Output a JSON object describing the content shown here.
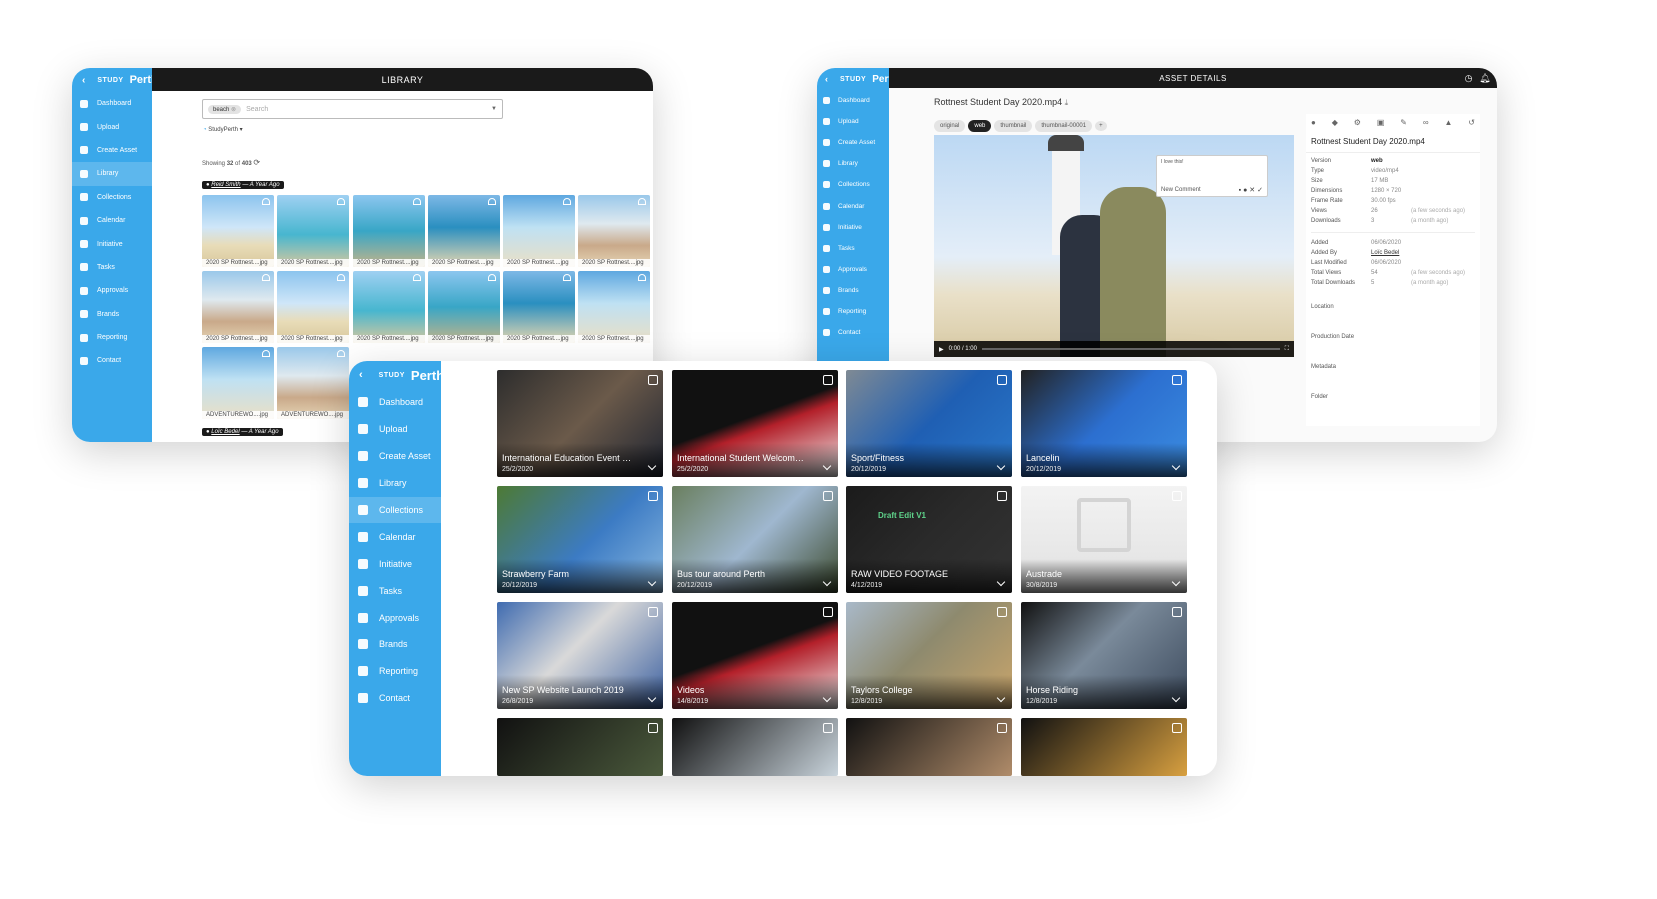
{
  "brand": {
    "study": "STUDY",
    "name": "Perth"
  },
  "nav": [
    {
      "label": "Dashboard",
      "icon": "dashboard-icon"
    },
    {
      "label": "Upload",
      "icon": "cloud-upload-icon"
    },
    {
      "label": "Create Asset",
      "icon": "create-asset-icon"
    },
    {
      "label": "Library",
      "icon": "library-icon"
    },
    {
      "label": "Collections",
      "icon": "collections-icon"
    },
    {
      "label": "Calendar",
      "icon": "calendar-icon"
    },
    {
      "label": "Initiative",
      "icon": "initiative-icon"
    },
    {
      "label": "Tasks",
      "icon": "tasks-icon"
    },
    {
      "label": "Approvals",
      "icon": "thumbs-up-icon"
    },
    {
      "label": "Brands",
      "icon": "brands-icon"
    },
    {
      "label": "Reporting",
      "icon": "reporting-icon"
    },
    {
      "label": "Contact",
      "icon": "help-icon"
    }
  ],
  "library": {
    "title": "LIBRARY",
    "search_tag": "beach",
    "search_placeholder": "Search",
    "brand_filter": "StudyPerth",
    "showing_prefix": "Showing",
    "showing_count": "32",
    "showing_of": "of",
    "showing_total": "403",
    "group1_user": "Reid Smith",
    "group1_when": "— A Year Ago",
    "group2_user": "Loïc Bedel",
    "group2_when": "— A Year Ago",
    "thumbs": [
      "2020 SP Rottnest....jpg",
      "2020 SP Rottnest....jpg",
      "2020 SP Rottnest....jpg",
      "2020 SP Rottnest....jpg",
      "2020 SP Rottnest....jpg",
      "2020 SP Rottnest....jpg",
      "2020 SP Rottnest....jpg",
      "2020 SP Rottnest....jpg",
      "2020 SP Rottnest....jpg",
      "2020 SP Rottnest....jpg",
      "2020 SP Rottnest....jpg",
      "2020 SP Rottnest....jpg",
      "ADVENTUREWO....jpg",
      "ADVENTUREWO....jpg"
    ]
  },
  "asset": {
    "title": "ASSET DETAILS",
    "file_name": "Rottnest Student Day 2020.mp4",
    "renditions": [
      "original",
      "web",
      "thumbnail",
      "thumbnail-00001"
    ],
    "active_rendition": "web",
    "comment_text": "I love this!",
    "new_comment": "New Comment",
    "player_time": "0:00 / 1:00",
    "panel_title": "Rottnest Student Day 2020.mp4",
    "meta1": [
      {
        "k": "Version",
        "v": "web",
        "x": ""
      },
      {
        "k": "Type",
        "v": "video/mp4",
        "x": ""
      },
      {
        "k": "Size",
        "v": "17 MB",
        "x": ""
      },
      {
        "k": "Dimensions",
        "v": "1280 × 720",
        "x": ""
      },
      {
        "k": "Frame Rate",
        "v": "30.00 fps",
        "x": ""
      },
      {
        "k": "Views",
        "v": "26",
        "x": "(a few seconds ago)"
      },
      {
        "k": "Downloads",
        "v": "3",
        "x": "(a month ago)"
      }
    ],
    "meta2": [
      {
        "k": "Added",
        "v": "06/06/2020",
        "x": ""
      },
      {
        "k": "Added By",
        "v": "Loïc Bedel",
        "x": ""
      },
      {
        "k": "Last Modified",
        "v": "06/06/2020",
        "x": ""
      },
      {
        "k": "Total Views",
        "v": "54",
        "x": "(a few seconds ago)"
      },
      {
        "k": "Total Downloads",
        "v": "5",
        "x": "(a month ago)"
      }
    ],
    "sections": [
      "Location",
      "Production Date",
      "Metadata",
      "Folder"
    ]
  },
  "collections": {
    "tiles": [
      {
        "title": "International Education Event S...",
        "date": "25/2/2020"
      },
      {
        "title": "International Student Welcome ...",
        "date": "25/2/2020"
      },
      {
        "title": "Sport/Fitness",
        "date": "20/12/2019"
      },
      {
        "title": "Lancelin",
        "date": "20/12/2019"
      },
      {
        "title": "Strawberry Farm",
        "date": "20/12/2019"
      },
      {
        "title": "Bus tour around Perth",
        "date": "20/12/2019"
      },
      {
        "title": "RAW VIDEO FOOTAGE",
        "date": "4/12/2019"
      },
      {
        "title": "Austrade",
        "date": "30/8/2019"
      },
      {
        "title": "New SP Website Launch 2019",
        "date": "26/8/2019"
      },
      {
        "title": "Videos",
        "date": "14/8/2019"
      },
      {
        "title": "Taylors College",
        "date": "12/8/2019"
      },
      {
        "title": "Horse Riding",
        "date": "12/8/2019"
      }
    ],
    "draft_label": "Draft Edit V1"
  },
  "colors": {
    "accent": "#3aa8ea",
    "topbar": "#1a1a1a"
  }
}
